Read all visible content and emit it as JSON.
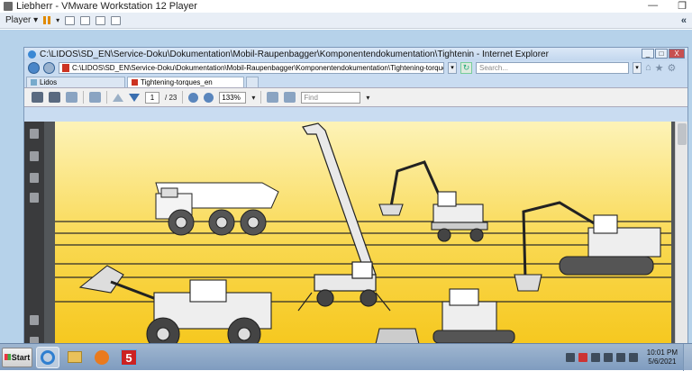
{
  "vmware": {
    "title": "Liebherr - VMware Workstation 12 Player",
    "player_menu": "Player ▾",
    "minimize_symbol": "—",
    "restore_symbol": "❐",
    "collapse_symbol": "«"
  },
  "ie": {
    "title": "C:\\LIDOS\\SD_EN\\Service-Doku\\Dokumentation\\Mobil-Raupenbagger\\Komponentendokumentation\\Tightenin - Internet Explorer",
    "address": "C:\\LIDOS\\SD_EN\\Service-Doku\\Dokumentation\\Mobil-Raupenbagger\\Komponentendokumentation\\Tightening-torques_en.pdf",
    "search_placeholder": "Search...",
    "tabs": [
      {
        "label": "Lidos"
      },
      {
        "label": "Tightening-torques_en"
      }
    ],
    "caption_buttons": {
      "min": "_",
      "max": "□",
      "close": "X"
    }
  },
  "pdf_toolbar": {
    "current_page": "1",
    "total_pages": "/ 23",
    "zoom": "133%",
    "find_placeholder": "Find"
  },
  "taskbar": {
    "start_label": "Start",
    "app5_label": "5",
    "time": "10:01 PM",
    "date": "5/6/2021"
  }
}
